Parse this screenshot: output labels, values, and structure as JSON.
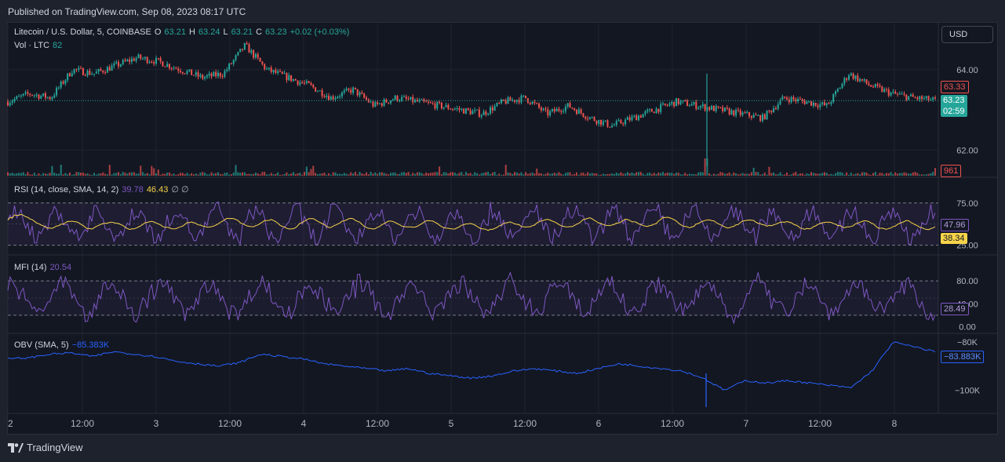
{
  "header": {
    "published": "Published on TradingView.com, Sep 08, 2023 08:17 UTC"
  },
  "legend": {
    "symbol": "Litecoin / U.S. Dollar, 5, COINBASE",
    "o_label": "O",
    "o": "63.21",
    "h_label": "H",
    "h": "63.24",
    "l_label": "L",
    "l": "63.21",
    "c_label": "C",
    "c": "63.23",
    "change": "+0.02 (+0.03%)",
    "vol_label": "Vol · LTC",
    "vol": "82"
  },
  "currency_button": "USD",
  "price_axis": {
    "ticks": [
      "64.00",
      "62.00"
    ],
    "last_tag": "63.23",
    "last_time": "02:59",
    "prev_tag": "63.33",
    "vol_tag": "961"
  },
  "rsi": {
    "label": "RSI (14, close, SMA, 14, 2)",
    "value": "39.78",
    "sma": "46.43",
    "extra": "∅ ∅",
    "ticks": [
      "75.00",
      "25.00"
    ],
    "tag_top": "47.96",
    "tag_bottom": "38.34"
  },
  "mfi": {
    "label": "MFI (14)",
    "value": "20.54",
    "ticks": [
      "80.00",
      "40.00",
      "0.00"
    ],
    "tag": "28.49"
  },
  "obv": {
    "label": "OBV (SMA, 5)",
    "value": "−85.383K",
    "ticks": [
      "−80K",
      "−100K"
    ],
    "tag": "−83.883K"
  },
  "time_axis": [
    "2",
    "12:00",
    "3",
    "12:00",
    "4",
    "12:00",
    "5",
    "12:00",
    "6",
    "12:00",
    "7",
    "12:00",
    "8"
  ],
  "footer": {
    "brand": "TradingView"
  },
  "colors": {
    "up": "#26a69a",
    "down": "#ef5350",
    "rsi": "#7e57c2",
    "rsi_sma": "#f7d34a",
    "mfi": "#7e57c2",
    "obv": "#2962ff",
    "grid": "#1f2330",
    "bg": "#131722"
  },
  "chart_data": [
    {
      "type": "candlestick",
      "title": "Litecoin / U.S. Dollar, 5, COINBASE",
      "x": [
        "2",
        "12:00",
        "3",
        "12:00",
        "4",
        "12:00",
        "5",
        "12:00",
        "6",
        "12:00",
        "7",
        "12:00",
        "8"
      ],
      "y_ticks": [
        64.0,
        62.0
      ],
      "ylim": [
        61.4,
        64.6
      ],
      "close_path": [
        63.2,
        63.4,
        63.3,
        64.0,
        63.9,
        64.1,
        64.3,
        64.2,
        64.0,
        63.8,
        63.9,
        64.6,
        64.0,
        63.8,
        63.6,
        63.3,
        63.5,
        63.1,
        63.3,
        63.2,
        63.1,
        63.0,
        62.9,
        63.2,
        63.3,
        62.9,
        63.1,
        62.8,
        62.6,
        62.8,
        63.0,
        63.2,
        63.1,
        63.0,
        62.9,
        62.8,
        63.3,
        63.2,
        63.1,
        63.9,
        63.6,
        63.4,
        63.3,
        63.23
      ],
      "last_price": 63.23
    },
    {
      "type": "line",
      "name": "RSI",
      "y_ticks": [
        75,
        25
      ],
      "ylim": [
        20,
        85
      ]
    },
    {
      "type": "line",
      "name": "MFI",
      "y_ticks": [
        80,
        40,
        0
      ],
      "ylim": [
        -5,
        105
      ]
    },
    {
      "type": "line",
      "name": "OBV",
      "y_ticks": [
        -80,
        -100
      ],
      "ylim": [
        -108,
        -78
      ]
    }
  ]
}
